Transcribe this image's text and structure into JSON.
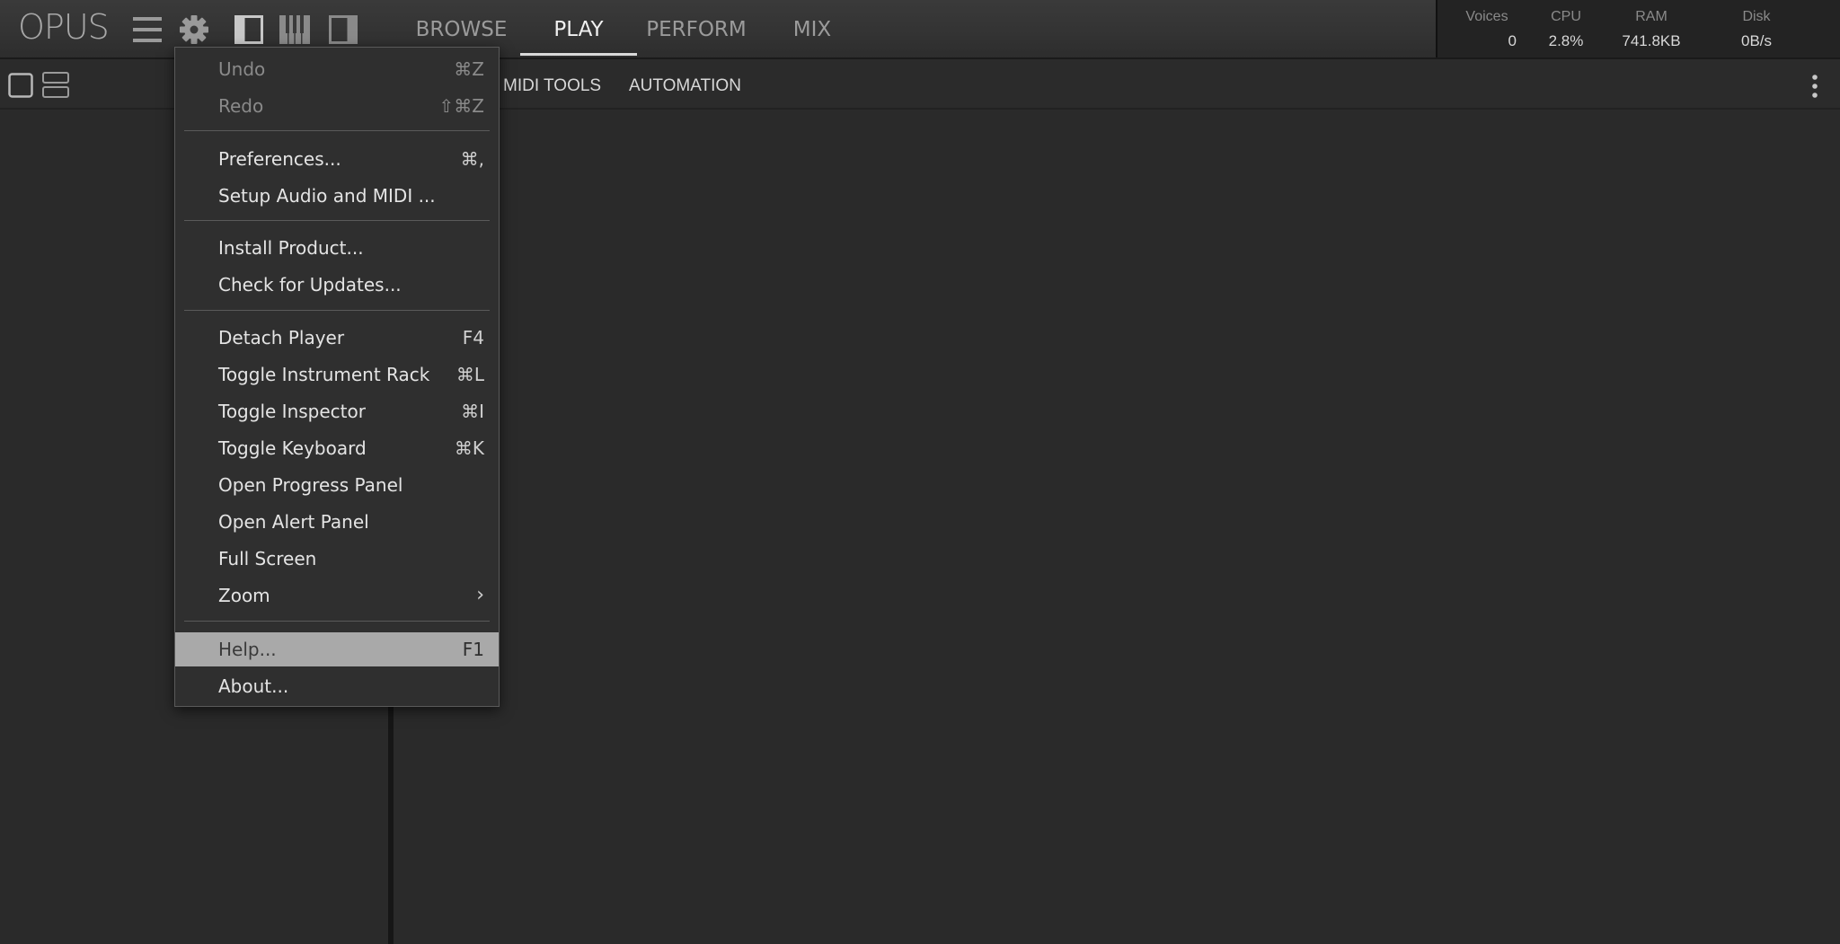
{
  "app": {
    "logo": "OPUS"
  },
  "nav": [
    {
      "label": "BROWSE"
    },
    {
      "label": "PLAY",
      "active": true
    },
    {
      "label": "PERFORM"
    },
    {
      "label": "MIX"
    }
  ],
  "stats": {
    "voices": {
      "label": "Voices",
      "value": "0"
    },
    "cpu": {
      "label": "CPU",
      "value": "2.8%"
    },
    "ram": {
      "label": "RAM",
      "value": "741.8KB"
    },
    "disk": {
      "label": "Disk",
      "value": "0B/s"
    }
  },
  "subtabs": {
    "midi_tools": "MIDI TOOLS",
    "automation": "AUTOMATION"
  },
  "menu": {
    "undo": {
      "label": "Undo",
      "shortcut": "⌘Z"
    },
    "redo": {
      "label": "Redo",
      "shortcut": "⇧⌘Z"
    },
    "preferences": {
      "label": "Preferences...",
      "shortcut": "⌘,"
    },
    "setup_audio": {
      "label": "Setup Audio and MIDI ..."
    },
    "install_product": {
      "label": "Install Product..."
    },
    "check_updates": {
      "label": "Check for Updates..."
    },
    "detach_player": {
      "label": "Detach Player",
      "shortcut": "F4"
    },
    "toggle_rack": {
      "label": "Toggle Instrument Rack",
      "shortcut": "⌘L"
    },
    "toggle_inspector": {
      "label": "Toggle Inspector",
      "shortcut": "⌘I"
    },
    "toggle_keyboard": {
      "label": "Toggle Keyboard",
      "shortcut": "⌘K"
    },
    "progress_panel": {
      "label": "Open Progress Panel"
    },
    "alert_panel": {
      "label": "Open Alert Panel"
    },
    "full_screen": {
      "label": "Full Screen"
    },
    "zoom": {
      "label": "Zoom",
      "submenu": "›"
    },
    "help": {
      "label": "Help...",
      "shortcut": "F1"
    },
    "about": {
      "label": "About..."
    }
  },
  "colors": {
    "background": "#282828",
    "menu_bg": "#2f2f2f",
    "menu_highlight": "#a9a9a9",
    "active_tab": "#f0f0f0"
  },
  "icons": [
    "hamburger-menu-icon",
    "gear-icon",
    "left-panel-icon",
    "keyboard-icon",
    "right-panel-icon",
    "single-layout-icon",
    "split-layout-icon",
    "more-vertical-icon"
  ]
}
